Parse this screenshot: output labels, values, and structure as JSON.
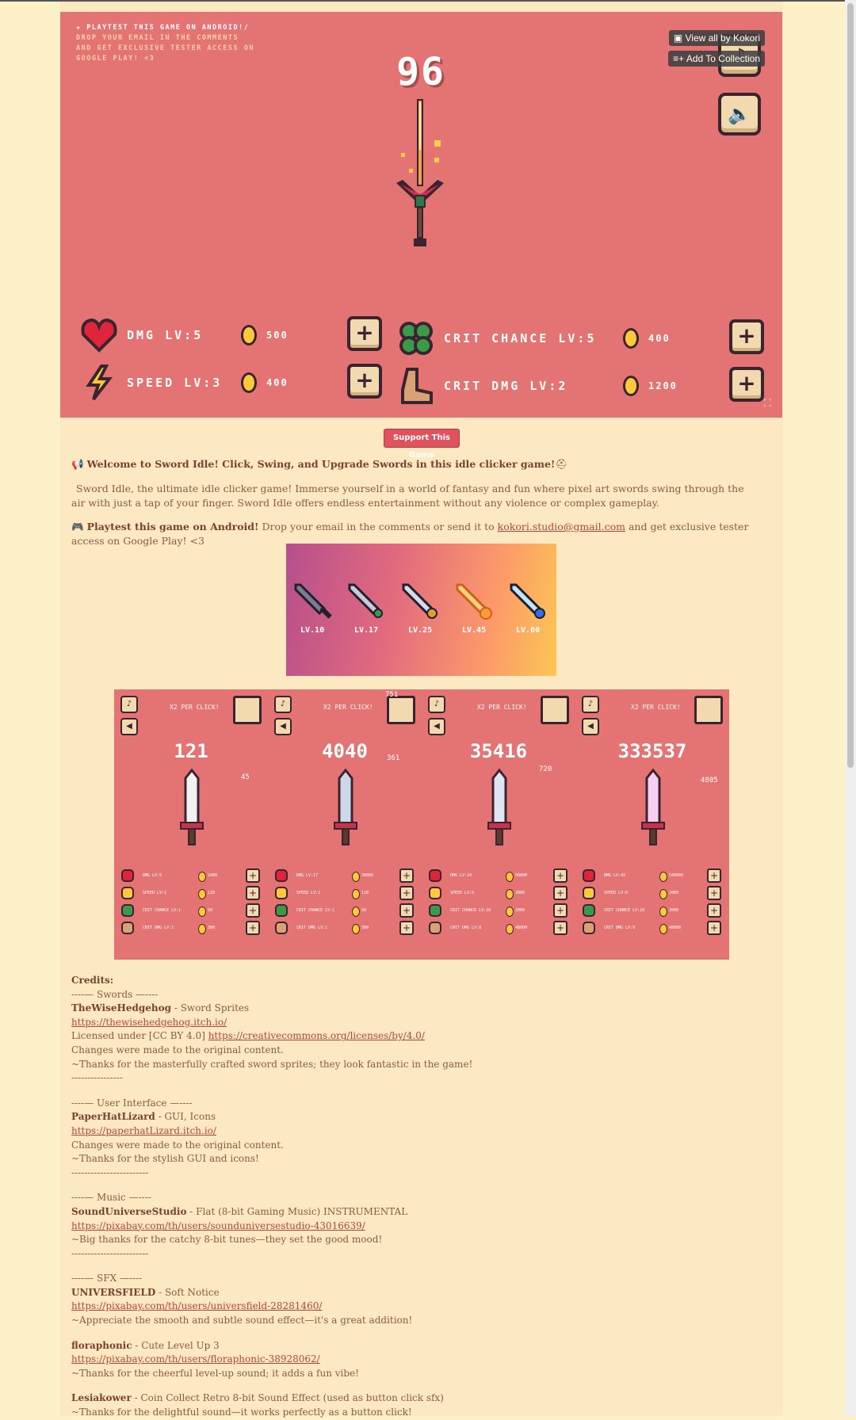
{
  "game": {
    "playtest_lines": [
      "★ PLAYTEST THIS GAME ON ANDROID!/",
      "DROP YOUR EMAIL IN THE COMMENTS",
      "AND GET EXCLUSIVE TESTER ACCESS ON",
      "GOOGLE PLAY! <3"
    ],
    "score": "96",
    "stats": [
      {
        "label": "DMG LV:5",
        "cost": "500"
      },
      {
        "label": "SPEED LV:3",
        "cost": "400"
      },
      {
        "label": "CRIT CHANCE LV:5",
        "cost": "400"
      },
      {
        "label": "CRIT DMG LV:2",
        "cost": "1200"
      }
    ],
    "plus": "+"
  },
  "overlay": {
    "view_all": "View all by Kokori",
    "add_collection": "Add To Collection"
  },
  "support_button": "Support This Game",
  "intro": {
    "welcome_emoji": "📢",
    "welcome": "Welcome to Sword Idle! Click, Swing, and Upgrade Swords in this idle clicker game!",
    "welcome_tail_emoji": "⛑",
    "description": "Sword Idle, the ultimate idle clicker game! Immerse yourself in a world of fantasy and fun where pixel art swords swing through the air with just a tap of your finger. Sword Idle offers endless entertainment without any violence or complex gameplay.",
    "playtest_emoji": "🎮",
    "playtest_bold": "Playtest this game on Android!",
    "playtest_text1": " Drop your email in the comments or send it to ",
    "email": "kokori.studio@gmail.com",
    "playtest_text2": " and get exclusive tester access on Google Play! <3"
  },
  "banner": {
    "levels": [
      "LV.10",
      "LV.17",
      "LV.25",
      "LV.45",
      "LV.60"
    ]
  },
  "screens": [
    {
      "x2": "X2 PER CLICK!",
      "score": "121",
      "small": "45",
      "stats": [
        [
          "DMG LV:5",
          "2400"
        ],
        [
          "SPEED LV:1",
          "120"
        ],
        [
          "CRIT CHANCE LV:1",
          "50"
        ],
        [
          "CRIT DMG LV:1",
          "300"
        ]
      ]
    },
    {
      "x2": "X2 PER CLICK!",
      "score": "4040",
      "small": "361",
      "top": "751",
      "stats": [
        [
          "DMG LV:17",
          "30000"
        ],
        [
          "SPEED LV:1",
          "120"
        ],
        [
          "CRIT CHANCE LV:1",
          "50"
        ],
        [
          "CRIT DMG LV:1",
          "300"
        ]
      ]
    },
    {
      "x2": "X2 PER CLICK!",
      "score": "35416",
      "small": "720",
      "stats": [
        [
          "DMG LV:24",
          "50000"
        ],
        [
          "SPEED LV:6",
          "2000"
        ],
        [
          "CRIT CHANCE LV:10",
          "2000"
        ],
        [
          "CRIT DMG LV:8",
          "48000"
        ]
      ]
    },
    {
      "x2": "X2 PER CLICK!",
      "score": "333537",
      "small": "4805",
      "stats": [
        [
          "DMG LV:42",
          "530000"
        ],
        [
          "SPEED LV:6",
          "2000"
        ],
        [
          "CRIT CHANCE LV:10",
          "2000"
        ],
        [
          "CRIT DMG LV:9",
          "48000"
        ]
      ]
    }
  ],
  "credits": {
    "title": "Credits:",
    "swords_head": "----— Swords —----",
    "swords_name": "TheWiseHedgehog",
    "swords_role": " - Sword Sprites",
    "swords_link": "https://thewisehedgehog.itch.io/",
    "swords_license": "Licensed under [CC BY 4.0] ",
    "swords_license_link": "https://creativecommons.org/licenses/by/4.0/",
    "swords_changes": "Changes were made to the original content.",
    "swords_thanks": "~Thanks for the masterfully crafted sword sprites; they look fantastic in the game!",
    "swords_rule": "----------------",
    "ui_head": "----— User Interface —----",
    "ui_name": "PaperHatLizard",
    "ui_role": " - GUI, Icons",
    "ui_link": "https://paperhatLizard.itch.io/",
    "ui_changes": "Changes were made to the original content.",
    "ui_thanks": "~Thanks for the stylish GUI and icons!",
    "ui_rule": "------------------------",
    "music_head": "----— Music —----",
    "music_name": "SoundUniverseStudio",
    "music_role": " - Flat (8-bit Gaming Music) INSTRUMENTAL",
    "music_link": "https://pixabay.com/th/users/sounduniversestudio-43016639/",
    "music_thanks": "~Big thanks for the catchy 8-bit tunes—they set the good mood!",
    "music_rule": "------------------------",
    "sfx_head": "----— SFX —----",
    "sfx1_name": "UNIVERSFIELD",
    "sfx1_role": " - Soft Notice",
    "sfx1_link": "https://pixabay.com/th/users/universfield-28281460/",
    "sfx1_thanks": "~Appreciate the smooth and subtle sound effect—it's a great addition!",
    "sfx2_name": "floraphonic",
    "sfx2_role": " - Cute Level Up 3",
    "sfx2_link": "https://pixabay.com/th/users/floraphonic-38928062/",
    "sfx2_thanks": "~Thanks for the cheerful level-up sound; it adds a fun vibe!",
    "sfx3_name": "Lesiakower",
    "sfx3_role": " - Coin Collect Retro 8-bit Sound Effect (used as button click sfx)",
    "sfx3_thanks": "~Thanks for the delightful sound—it works perfectly as a button click!"
  }
}
